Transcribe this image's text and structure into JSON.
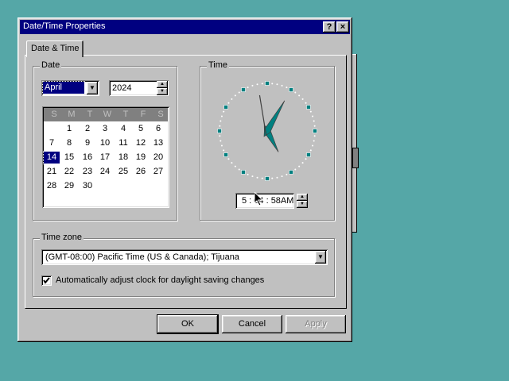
{
  "window": {
    "title": "Date/Time Properties",
    "help_label": "?",
    "close_label": "×"
  },
  "tabs": [
    {
      "label": "Date & Time"
    }
  ],
  "date": {
    "label": "Date",
    "month": "April",
    "year": "2024",
    "weekdays": [
      "S",
      "M",
      "T",
      "W",
      "T",
      "F",
      "S"
    ],
    "selected_day": "14",
    "weeks": [
      [
        "",
        "1",
        "2",
        "3",
        "4",
        "5",
        "6"
      ],
      [
        "7",
        "8",
        "9",
        "10",
        "11",
        "12",
        "13"
      ],
      [
        "14",
        "15",
        "16",
        "17",
        "18",
        "19",
        "20"
      ],
      [
        "21",
        "22",
        "23",
        "24",
        "25",
        "26",
        "27"
      ],
      [
        "28",
        "29",
        "30",
        "",
        "",
        "",
        ""
      ]
    ]
  },
  "time": {
    "label": "Time",
    "value": "5 : 04 : 58AM",
    "clock": {
      "hours": 5,
      "minutes": 4,
      "seconds": 58
    }
  },
  "timezone": {
    "label": "Time zone",
    "selected": "(GMT-08:00) Pacific Time (US & Canada); Tijuana",
    "dst_label": "Automatically adjust clock for daylight saving changes",
    "dst_checked": true
  },
  "buttons": {
    "ok": "OK",
    "cancel": "Cancel",
    "apply": "Apply"
  },
  "colors": {
    "desktop": "#55a7a7",
    "titlebar": "#000080",
    "clock_ticks": "#008080"
  }
}
